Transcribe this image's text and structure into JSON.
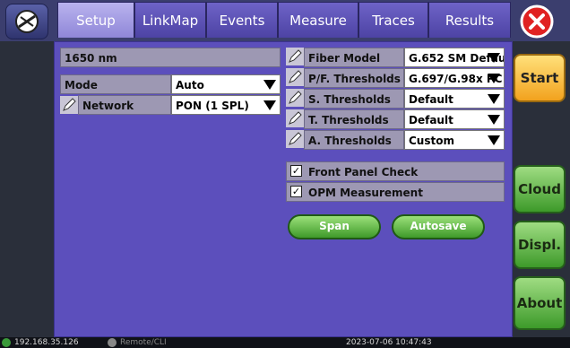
{
  "tabs": [
    {
      "label": "Setup",
      "active": true
    },
    {
      "label": "LinkMap",
      "active": false
    },
    {
      "label": "Events",
      "active": false
    },
    {
      "label": "Measure",
      "active": false
    },
    {
      "label": "Traces",
      "active": false
    },
    {
      "label": "Results",
      "active": false
    }
  ],
  "left": {
    "wavelength": "1650 nm",
    "mode_label": "Mode",
    "mode_value": "Auto",
    "network_label": "Network",
    "network_value": "PON (1 SPL)"
  },
  "right": {
    "rows": [
      {
        "label": "Fiber Model",
        "value": "G.652 SM Defau"
      },
      {
        "label": "P/F. Thresholds",
        "value": "G.697/G.98x PC"
      },
      {
        "label": "S. Thresholds",
        "value": "Default"
      },
      {
        "label": "T. Thresholds",
        "value": "Default"
      },
      {
        "label": "A. Thresholds",
        "value": "Custom"
      }
    ],
    "checks": [
      {
        "label": "Front Panel Check",
        "checked": true
      },
      {
        "label": "OPM Measurement",
        "checked": true
      }
    ]
  },
  "buttons": {
    "span": "Span",
    "autosave": "Autosave"
  },
  "side": {
    "start": "Start",
    "cloud": "Cloud",
    "displ": "Displ.",
    "about": "About"
  },
  "status": {
    "ip": "192.168.35.126",
    "remote": "Remote/CLI",
    "datetime": "2023-07-06  10:47:43"
  },
  "colors": {
    "panel": "#5c4fbc",
    "accent_green": "#3f9a2a",
    "start_orange": "#f2a21e",
    "close_red": "#e02222"
  },
  "icons": [
    "home-icon",
    "close-icon",
    "pencil-icon",
    "checkbox-icon",
    "dropdown-arrow-icon",
    "network-status-icon"
  ]
}
